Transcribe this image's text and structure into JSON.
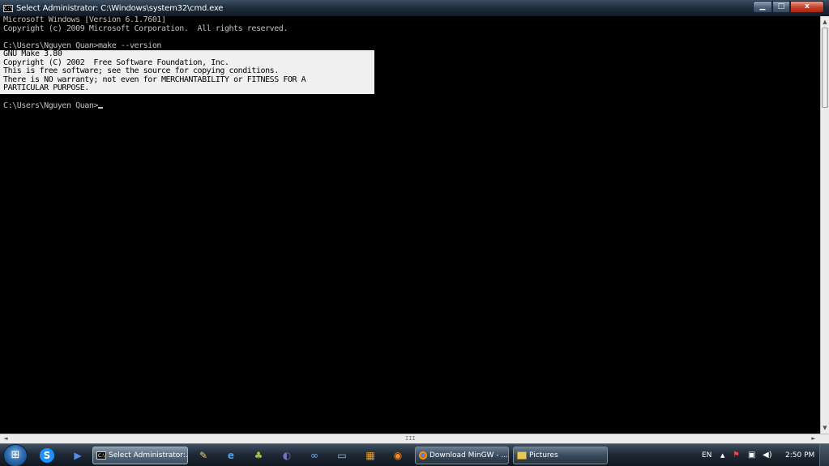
{
  "window": {
    "title": "Select Administrator: C:\\Windows\\system32\\cmd.exe",
    "icon": "cmd-icon",
    "icon_text": "C:\\",
    "buttons": {
      "minimize": "▁",
      "maximize": "□",
      "close": "x"
    }
  },
  "console": {
    "lines": [
      "Microsoft Windows [Version 6.1.7601]",
      "Copyright (c) 2009 Microsoft Corporation.  All rights reserved.",
      "",
      "C:\\Users\\Nguyen Quan>make --version"
    ],
    "selected_lines": [
      "GNU Make 3.80",
      "Copyright (C) 2002  Free Software Foundation, Inc.",
      "This is free software; see the source for copying conditions.",
      "There is NO warranty; not even for MERCHANTABILITY or FITNESS FOR A",
      "PARTICULAR PURPOSE."
    ],
    "trailing_blank": "",
    "prompt": "C:\\Users\\Nguyen Quan>"
  },
  "scrollbars": {
    "up": "▲",
    "down": "▼",
    "left": "◄",
    "right": "►",
    "grip": "III"
  },
  "taskbar": {
    "start_icon": "windows-logo-icon",
    "start_glyph": "⊞",
    "pinned": [
      {
        "name": "skype-icon",
        "glyph": "S",
        "color": "#1e90ff"
      },
      {
        "name": "media-player-icon",
        "glyph": "▶",
        "color": "#2a6fd6"
      }
    ],
    "tasks": [
      {
        "label": "Select Administrator:...",
        "icon": "cmd-icon",
        "active": true
      },
      {
        "label": "Download MinGW - ...",
        "icon": "chrome-icon",
        "active": false
      },
      {
        "label": "Pictures",
        "icon": "folder-icon",
        "active": false
      }
    ],
    "quick_launch": [
      {
        "name": "notepad-icon",
        "glyph": "✎",
        "color": "#e8d36b"
      },
      {
        "name": "ie-icon",
        "glyph": "e",
        "color": "#4aa3e8"
      },
      {
        "name": "pear-icon",
        "glyph": "♣",
        "color": "#9bc83d"
      },
      {
        "name": "eclipse-icon",
        "glyph": "◐",
        "color": "#7a6fd0"
      },
      {
        "name": "infinity-icon",
        "glyph": "∞",
        "color": "#6fb2ff"
      },
      {
        "name": "screen-icon",
        "glyph": "▭",
        "color": "#8fc1ee"
      },
      {
        "name": "windows-flag-icon",
        "glyph": "▦",
        "color": "#f0a020"
      },
      {
        "name": "firefox-icon",
        "glyph": "◉",
        "color": "#ff8a1c"
      }
    ],
    "tray": {
      "language": "EN",
      "show_hidden": "▲",
      "clock": "2:50 PM"
    }
  }
}
